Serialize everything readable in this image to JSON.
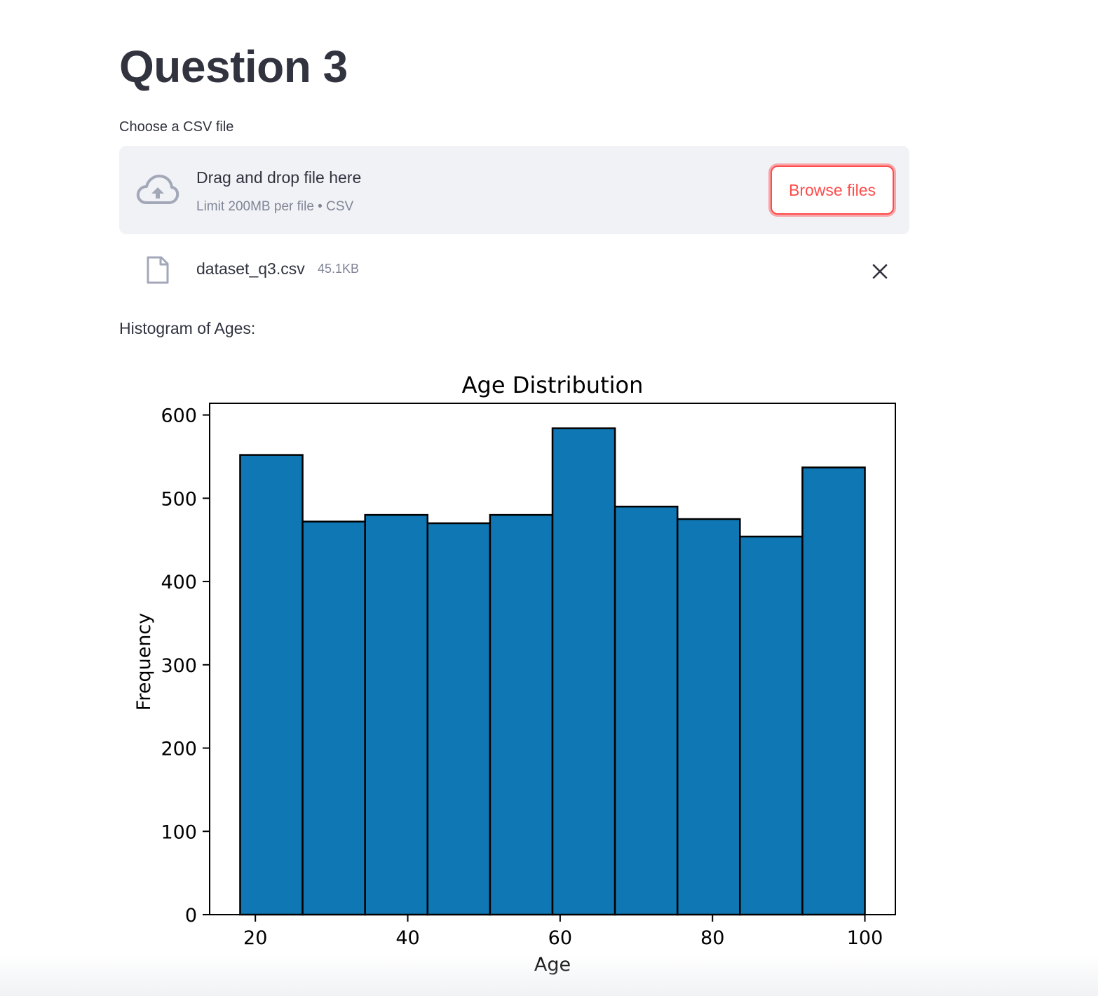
{
  "page": {
    "title": "Question 3"
  },
  "uploader": {
    "label": "Choose a CSV file",
    "drop_primary": "Drag and drop file here",
    "drop_secondary": "Limit 200MB per file • CSV",
    "browse_label": "Browse files",
    "icon": "cloud-upload-icon"
  },
  "uploaded_file": {
    "name": "dataset_q3.csv",
    "size": "45.1KB",
    "icon": "file-icon",
    "remove_icon": "close-icon"
  },
  "histogram_caption": "Histogram of Ages:",
  "colors": {
    "accent": "#ff4b4b",
    "bar_fill": "#0f78b4",
    "text": "#31333f",
    "muted": "#808495"
  },
  "chart_data": {
    "type": "bar",
    "title": "Age Distribution",
    "xlabel": "Age",
    "ylabel": "Frequency",
    "bin_edges": [
      18,
      26.2,
      34.4,
      42.6,
      50.8,
      59,
      67.2,
      75.4,
      83.6,
      91.8,
      100
    ],
    "values": [
      552,
      472,
      480,
      470,
      480,
      584,
      490,
      475,
      454,
      537
    ],
    "xlim": [
      14,
      104
    ],
    "ylim": [
      0,
      614
    ],
    "xticks": [
      20,
      40,
      60,
      80,
      100
    ],
    "yticks": [
      0,
      100,
      200,
      300,
      400,
      500,
      600
    ],
    "grid": false
  }
}
